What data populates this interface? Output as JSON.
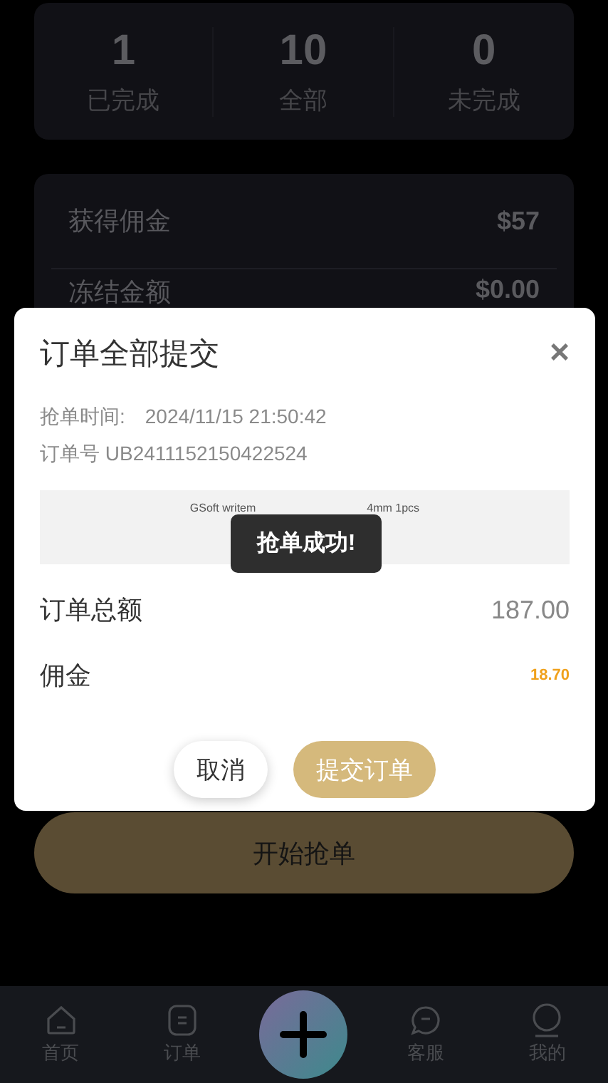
{
  "stats": [
    {
      "value": "1",
      "label": "已完成"
    },
    {
      "value": "10",
      "label": "全部"
    },
    {
      "value": "0",
      "label": "未完成"
    }
  ],
  "summary": [
    {
      "label": "获得佣金",
      "value": "$57"
    },
    {
      "label": "冻结金额",
      "value": "$0.00"
    }
  ],
  "start_button": "开始抢单",
  "nav": [
    {
      "kind": "home",
      "label": "首页"
    },
    {
      "kind": "orders",
      "label": "订单"
    },
    {
      "kind": "add"
    },
    {
      "kind": "service",
      "label": "客服"
    },
    {
      "kind": "profile",
      "label": "我的"
    }
  ],
  "dialog": {
    "title": "订单全部提交",
    "close": "×",
    "grab_time_label": "抢单时间:",
    "grab_time": "2024/11/15 21:50:42",
    "order_no": "订单号 UB2411152150422524",
    "product_start": "GSoft writem",
    "product_end": "4mm 1pcs",
    "total_label": "订单总额",
    "total": "187.00",
    "commission_label": "佣金",
    "commission": "18.70",
    "cancel": "取消",
    "submit": "提交订单"
  },
  "toast": "抢单成功!"
}
